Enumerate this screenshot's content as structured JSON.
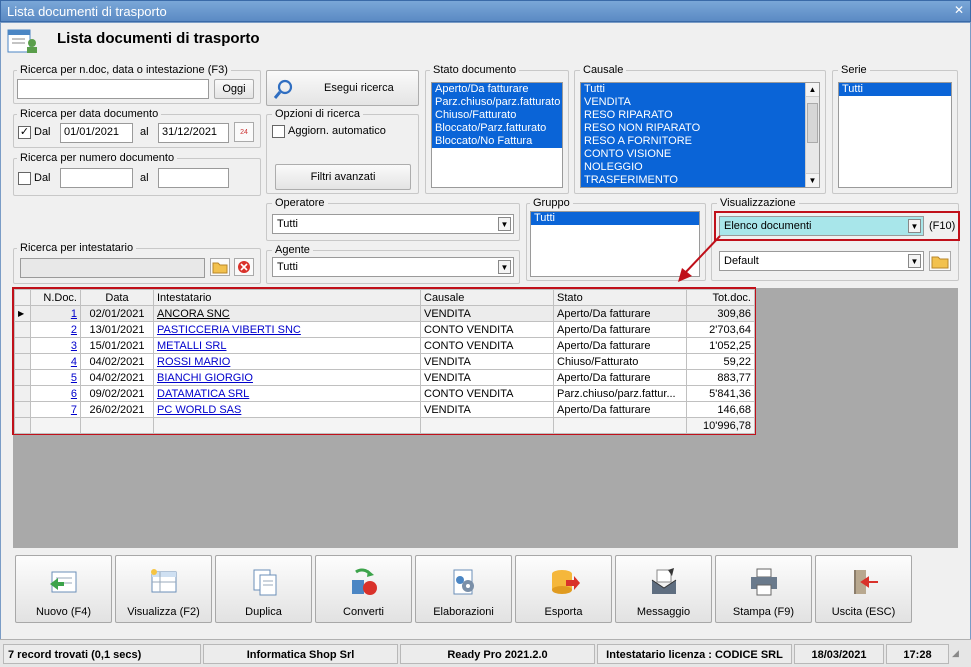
{
  "window": {
    "title": "Lista documenti di trasporto"
  },
  "header": {
    "title": "Lista documenti di trasporto"
  },
  "search_ndoc": {
    "label": "Ricerca per n.doc, data o intestazione (F3)",
    "value": "",
    "button": "Oggi"
  },
  "search_date": {
    "label": "Ricerca per data documento",
    "dal_label": "Dal",
    "dal_checked": true,
    "from": "01/01/2021",
    "al_label": "al",
    "to": "31/12/2021",
    "calendar_text": "24"
  },
  "search_number": {
    "label": "Ricerca per numero documento",
    "dal_label": "Dal",
    "dal_checked": false,
    "from": "",
    "al_label": "al",
    "to": ""
  },
  "search_holder": {
    "label": "Ricerca per intestatario",
    "value": ""
  },
  "run_search": {
    "label": "Esegui ricerca"
  },
  "options": {
    "label": "Opzioni di ricerca",
    "auto_update": "Aggiorn. automatico",
    "auto_checked": false
  },
  "advanced": {
    "label": "Filtri avanzati"
  },
  "operator": {
    "label": "Operatore",
    "value": "Tutti"
  },
  "agent": {
    "label": "Agente",
    "value": "Tutti"
  },
  "doc_state": {
    "label": "Stato documento",
    "items": [
      "Aperto/Da fatturare",
      "Parz.chiuso/parz.fatturato",
      "Chiuso/Fatturato",
      "Bloccato/Parz.fatturato",
      "Bloccato/No Fattura"
    ]
  },
  "causale": {
    "label": "Causale",
    "items": [
      "Tutti",
      "VENDITA",
      "RESO RIPARATO",
      "RESO NON RIPARATO",
      "RESO A FORNITORE",
      "CONTO VISIONE",
      "NOLEGGIO",
      "TRASFERIMENTO"
    ]
  },
  "serie": {
    "label": "Serie",
    "items": [
      "Tutti"
    ]
  },
  "gruppo": {
    "label": "Gruppo",
    "items": [
      "Tutti"
    ]
  },
  "visualizzazione": {
    "label": "Visualizzazione",
    "value": "Elenco documenti",
    "shortcut": "(F10)",
    "layout": "Default"
  },
  "grid": {
    "columns": [
      "N.Doc.",
      "Data",
      "Intestatario",
      "Causale",
      "Stato",
      "Tot.doc."
    ],
    "rows": [
      {
        "ndoc": "1",
        "data": "02/01/2021",
        "intestatario": "ANCORA SNC",
        "causale": "VENDITA",
        "stato": "Aperto/Da fatturare",
        "tot": "309,86"
      },
      {
        "ndoc": "2",
        "data": "13/01/2021",
        "intestatario": "PASTICCERIA VIBERTI SNC",
        "causale": "CONTO VENDITA",
        "stato": "Aperto/Da fatturare",
        "tot": "2'703,64"
      },
      {
        "ndoc": "3",
        "data": "15/01/2021",
        "intestatario": "METALLI SRL",
        "causale": "CONTO VENDITA",
        "stato": "Aperto/Da fatturare",
        "tot": "1'052,25"
      },
      {
        "ndoc": "4",
        "data": "04/02/2021",
        "intestatario": "ROSSI MARIO",
        "causale": "VENDITA",
        "stato": "Chiuso/Fatturato",
        "tot": "59,22"
      },
      {
        "ndoc": "5",
        "data": "04/02/2021",
        "intestatario": "BIANCHI GIORGIO",
        "causale": "VENDITA",
        "stato": "Aperto/Da fatturare",
        "tot": "883,77"
      },
      {
        "ndoc": "6",
        "data": "09/02/2021",
        "intestatario": "DATAMATICA SRL",
        "causale": "CONTO VENDITA",
        "stato": "Parz.chiuso/parz.fattur...",
        "tot": "5'841,36"
      },
      {
        "ndoc": "7",
        "data": "26/02/2021",
        "intestatario": "PC WORLD SAS",
        "causale": "VENDITA",
        "stato": "Aperto/Da fatturare",
        "tot": "146,68"
      }
    ],
    "total": "10'996,78"
  },
  "toolbar": [
    {
      "label": "Nuovo (F4)",
      "icon": "new-document-icon"
    },
    {
      "label": "Visualizza (F2)",
      "icon": "view-icon"
    },
    {
      "label": "Duplica",
      "icon": "duplicate-icon"
    },
    {
      "label": "Converti",
      "icon": "convert-icon"
    },
    {
      "label": "Elaborazioni",
      "icon": "gears-icon"
    },
    {
      "label": "Esporta",
      "icon": "export-icon"
    },
    {
      "label": "Messaggio",
      "icon": "message-icon"
    },
    {
      "label": "Stampa (F9)",
      "icon": "printer-icon"
    },
    {
      "label": "Uscita (ESC)",
      "icon": "exit-icon"
    }
  ],
  "status": {
    "records": "7 record trovati (0,1 secs)",
    "company": "Informatica Shop Srl",
    "version": "Ready Pro 2021.2.0",
    "license": "Intestatario licenza : CODICE SRL",
    "date": "18/03/2021",
    "time": "17:28"
  }
}
